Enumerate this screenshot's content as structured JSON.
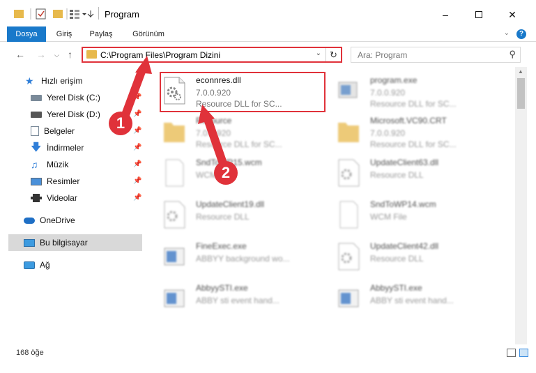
{
  "window": {
    "title": "Program",
    "minimize_icon": "minimize-icon",
    "maximize_icon": "maximize-icon",
    "close_icon": "close-icon"
  },
  "ribbon": {
    "tabs": [
      "Dosya",
      "Giriş",
      "Paylaş",
      "Görünüm"
    ],
    "active_tab": "Dosya",
    "help_label": "?"
  },
  "nav": {
    "address": "C:\\Program Files\\Program Dizini",
    "search_placeholder": "Ara: Program"
  },
  "sidebar": {
    "items": [
      {
        "label": "Hızlı erişim",
        "icon": "star-icon"
      },
      {
        "label": "Yerel Disk (C:)",
        "icon": "drive-icon"
      },
      {
        "label": "Yerel Disk (D:)",
        "icon": "drive-icon"
      },
      {
        "label": "Belgeler",
        "icon": "documents-icon"
      },
      {
        "label": "İndirmeler",
        "icon": "download-icon"
      },
      {
        "label": "Müzik",
        "icon": "music-icon"
      },
      {
        "label": "Resimler",
        "icon": "pictures-icon"
      },
      {
        "label": "Videolar",
        "icon": "videos-icon"
      },
      {
        "label": "OneDrive",
        "icon": "cloud-icon"
      },
      {
        "label": "Bu bilgisayar",
        "icon": "computer-icon"
      },
      {
        "label": "Ağ",
        "icon": "network-icon"
      }
    ]
  },
  "files": [
    {
      "name": "econnres.dll",
      "line2": "7.0.0.920",
      "line3": "Resource DLL for SC...",
      "type": "dll"
    },
    {
      "name": "program.exe",
      "line2": "7.0.0.920",
      "line3": "Resource DLL for SC...",
      "type": "exe"
    },
    {
      "name": "Resource",
      "line2": "7.0.0.920",
      "line3": "Resource DLL for SC...",
      "type": "folder"
    },
    {
      "name": "Microsoft.VC90.CRT",
      "line2": "7.0.0.920",
      "line3": "Resource DLL for SC...",
      "type": "folder"
    },
    {
      "name": "SndToWP15.wcm",
      "line2": "WCM File",
      "line3": "",
      "type": "file"
    },
    {
      "name": "UpdateClient63.dll",
      "line2": "Resource DLL",
      "line3": "",
      "type": "dll"
    },
    {
      "name": "UpdateClient19.dll",
      "line2": "Resource DLL",
      "line3": "",
      "type": "dll"
    },
    {
      "name": "SndToWP14.wcm",
      "line2": "WCM File",
      "line3": "",
      "type": "file"
    },
    {
      "name": "FineExec.exe",
      "line2": "ABBYY background wo...",
      "line3": "",
      "type": "exe"
    },
    {
      "name": "UpdateClient42.dll",
      "line2": "Resource DLL",
      "line3": "",
      "type": "dll"
    },
    {
      "name": "AbbyySTI.exe",
      "line2": "ABBY sti event hand...",
      "line3": "",
      "type": "exe"
    },
    {
      "name": "AbbyySTI.exe",
      "line2": "ABBY sti event hand...",
      "line3": "",
      "type": "exe"
    }
  ],
  "status": {
    "item_count": "168 öğe"
  },
  "annotations": {
    "badge1": "1",
    "badge2": "2",
    "color": "#e0323a"
  }
}
